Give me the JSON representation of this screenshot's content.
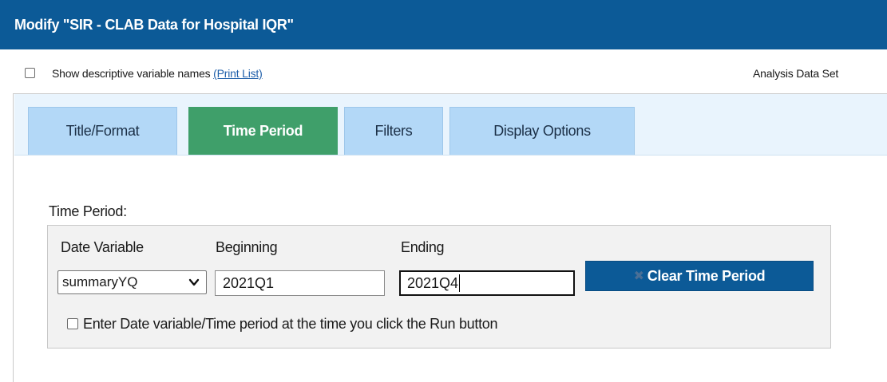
{
  "window": {
    "title": "Modify \"SIR - CLAB Data for Hospital IQR\""
  },
  "options": {
    "show_descriptive_label": "Show descriptive variable names",
    "print_list_link": "(Print List)",
    "show_descriptive_checked": false,
    "analysis_dataset_label": "Analysis Data Set"
  },
  "tabs": [
    {
      "label": "Title/Format",
      "active": false
    },
    {
      "label": "Time Period",
      "active": true
    },
    {
      "label": "Filters",
      "active": false
    },
    {
      "label": "Display Options",
      "active": false
    }
  ],
  "time_period": {
    "section_label": "Time Period:",
    "date_variable_label": "Date Variable",
    "date_variable_value": "summaryYQ",
    "beginning_label": "Beginning",
    "beginning_value": "2021Q1",
    "ending_label": "Ending",
    "ending_value": "2021Q4",
    "clear_button_label": "Clear Time Period",
    "enter_at_runtime_label": "Enter Date variable/Time period at the time you click the Run button",
    "enter_at_runtime_checked": false
  },
  "icons": {
    "select_arrow": "chevron-down-icon",
    "clear_button_icon": "close-icon"
  },
  "colors": {
    "header_bar": "#0c5a97",
    "active_tab": "#3f9f6a",
    "inactive_tab": "#b3d8f7",
    "tab_strip": "#e9f4fd",
    "button": "#0c5a97",
    "link": "#1f5faa"
  }
}
